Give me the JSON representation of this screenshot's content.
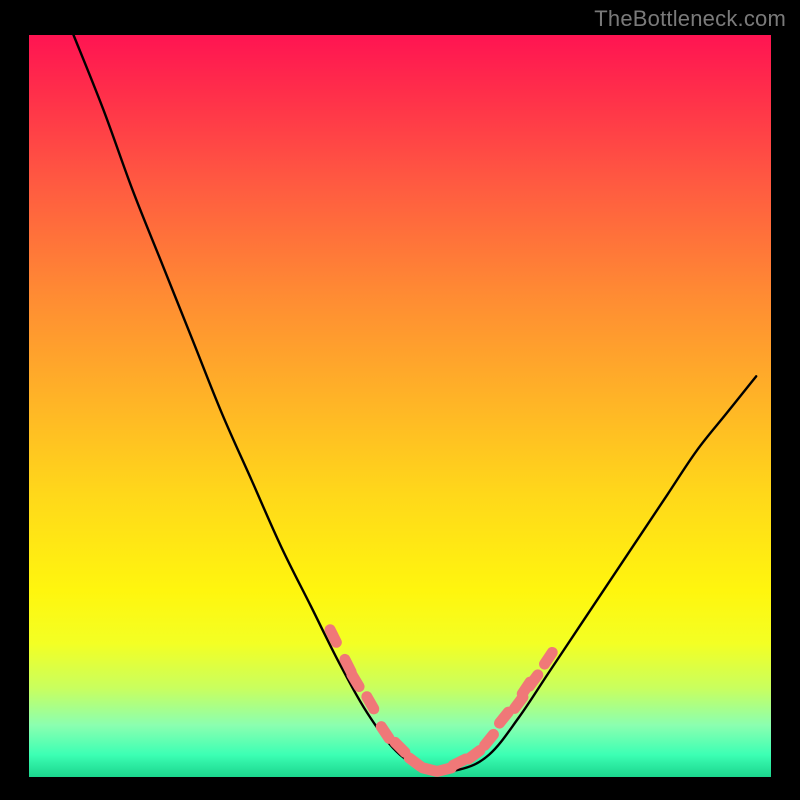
{
  "watermark": {
    "text": "TheBottleneck.com"
  },
  "chart_data": {
    "type": "line",
    "title": "",
    "xlabel": "",
    "ylabel": "",
    "xlim": [
      0,
      100
    ],
    "ylim": [
      0,
      100
    ],
    "series": [
      {
        "name": "bottleneck-curve",
        "x": [
          6,
          10,
          14,
          18,
          22,
          26,
          30,
          34,
          38,
          42,
          46,
          50,
          54,
          58,
          62,
          66,
          70,
          74,
          78,
          82,
          86,
          90,
          94,
          98
        ],
        "values": [
          100,
          90,
          79,
          69,
          59,
          49,
          40,
          31,
          23,
          15,
          8,
          3,
          1,
          1,
          3,
          8,
          14,
          20,
          26,
          32,
          38,
          44,
          49,
          54
        ]
      }
    ],
    "markers": {
      "name": "highlight-points",
      "x": [
        41,
        43,
        44,
        46,
        48,
        50,
        52,
        54,
        56,
        58,
        60,
        62,
        64,
        66,
        67,
        68,
        70
      ],
      "values": [
        19,
        15,
        13,
        10,
        6,
        4,
        2,
        1,
        1,
        2,
        3,
        5,
        8,
        10,
        12,
        13,
        16
      ]
    }
  }
}
